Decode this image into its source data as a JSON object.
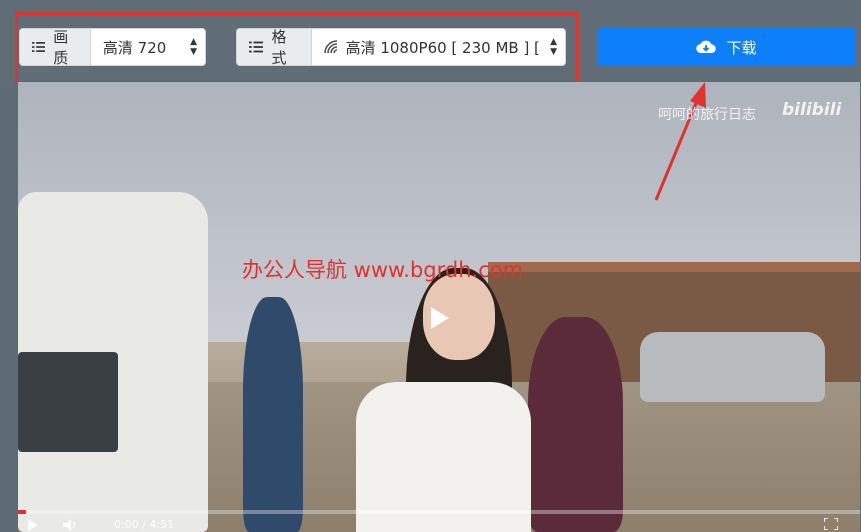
{
  "toolbar": {
    "quality": {
      "label": "画质",
      "selected": "高清 720"
    },
    "format": {
      "label": "格式",
      "selected": "高清 1080P60 [ 230 MB ] ["
    },
    "download_label": "下载"
  },
  "video": {
    "overlay_text": "办公人导航 www.bgrdh.com",
    "channel_name": "呵呵的旅行日志",
    "platform_logo": "bilibili",
    "progress": 0.01,
    "time_display": "0:00 / 4:51"
  },
  "colors": {
    "accent": "#0d7ffb",
    "highlight": "#e0322f",
    "toolbar_bg": "#616d76"
  },
  "icons": [
    "list-icon",
    "signal-icon",
    "cloud-download-icon",
    "play-icon",
    "volume-icon",
    "fullscreen-icon"
  ]
}
